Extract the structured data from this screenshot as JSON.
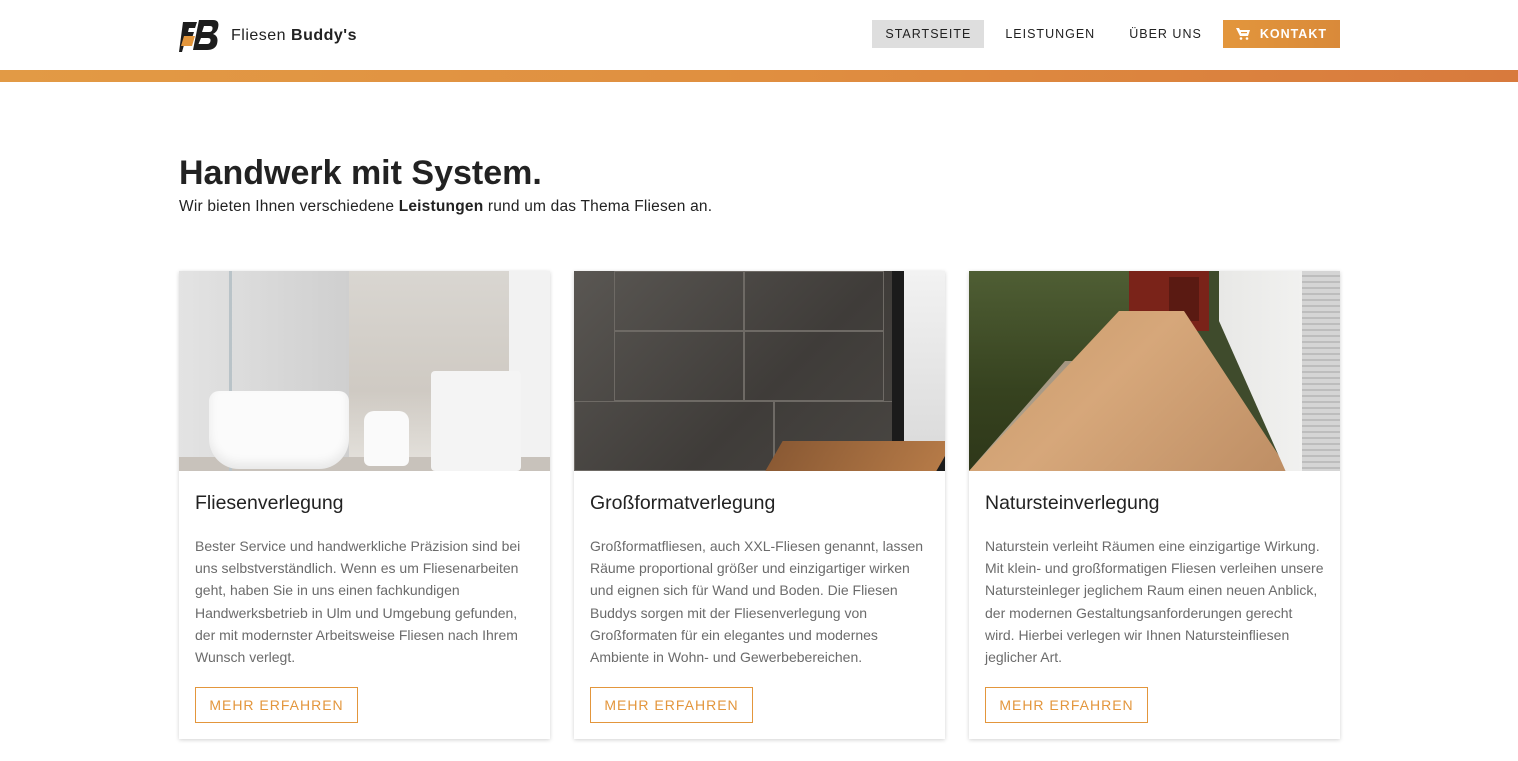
{
  "brand": {
    "name_light": "Fliesen",
    "name_bold": "Buddy's",
    "logo_letters": "FB"
  },
  "nav": {
    "items": [
      {
        "label": "STARTSEITE",
        "active": true
      },
      {
        "label": "LEISTUNGEN",
        "active": false
      },
      {
        "label": "ÜBER UNS",
        "active": false
      }
    ],
    "cta": {
      "label": "KONTAKT",
      "icon": "cart-icon"
    }
  },
  "hero": {
    "title_bold": "Handwerk",
    "title_rest": " mit System.",
    "sub_before": "Wir bieten Ihnen verschiedene ",
    "sub_bold": "Leistungen",
    "sub_after": " rund um das Thema Fliesen an."
  },
  "cards": [
    {
      "title": "Fliesenverlegung",
      "text": "Bester Service und handwerkliche Präzision sind bei uns selbstverständlich. Wenn es um Fliesenarbeiten geht, haben Sie in uns einen fachkundigen Handwerksbetrieb in Ulm und Umgebung gefunden, der mit modernster Arbeitsweise Fliesen nach Ihrem Wunsch verlegt.",
      "button": "MEHR ERFAHREN"
    },
    {
      "title": "Großformatverlegung",
      "text": "Großformatfliesen, auch XXL-Fliesen genannt, lassen Räume proportional größer und einzigartiger wirken und eignen sich für Wand und Boden. Die Fliesen Buddys sorgen mit der Fliesenverlegung von Großformaten für ein elegantes und modernes Ambiente in Wohn- und Gewerbebereichen.",
      "button": "MEHR ERFAHREN"
    },
    {
      "title": "Natursteinverlegung",
      "text": "Naturstein verleiht Räumen eine einzigartige Wirkung. Mit klein- und großformatigen Fliesen verleihen unsere Natursteinleger jeglichem Raum einen neuen Anblick, der modernen Gestaltungsanforderungen gerecht wird. Hierbei verlegen wir Ihnen Natursteinfliesen jeglicher Art.",
      "button": "MEHR ERFAHREN"
    }
  ],
  "colors": {
    "accent": "#e3963c",
    "accent_dark": "#d87a3d",
    "text": "#222222",
    "muted_text": "#6b6b6b"
  }
}
